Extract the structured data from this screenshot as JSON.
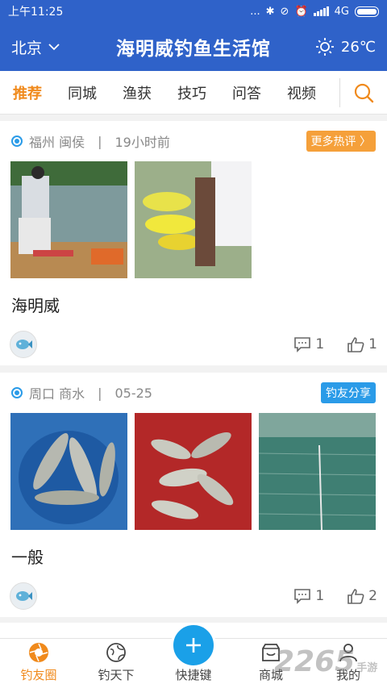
{
  "status_bar": {
    "time": "上午11:25",
    "network": "4G",
    "dots": "..."
  },
  "header": {
    "city": "北京",
    "title": "海明威钓鱼生活馆",
    "temperature": "26℃"
  },
  "tabs": [
    {
      "label": "推荐",
      "active": true
    },
    {
      "label": "同城"
    },
    {
      "label": "渔获"
    },
    {
      "label": "技巧"
    },
    {
      "label": "问答"
    },
    {
      "label": "视频"
    }
  ],
  "posts": [
    {
      "location": "福州 闽侯",
      "time": "19小时前",
      "badge": "更多热评 〉",
      "badge_color": "#f5a03a",
      "title": "海明威",
      "comments": "1",
      "likes": "1"
    },
    {
      "location": "周口 商水",
      "time": "05-25",
      "badge": "钓友分享",
      "badge_color": "#2a9be8",
      "title": "一般",
      "comments": "1",
      "likes": "2"
    }
  ],
  "bottom_nav": [
    {
      "label": "钓友圈",
      "icon": "aperture-icon",
      "active": true
    },
    {
      "label": "钓天下",
      "icon": "globe-icon"
    },
    {
      "label": "快捷键",
      "icon": "plus-icon"
    },
    {
      "label": "商城",
      "icon": "shop-icon"
    },
    {
      "label": "我的",
      "icon": "user-icon"
    }
  ],
  "watermark": {
    "text": "2265",
    "sub": "手游网"
  },
  "colors": {
    "primary": "#2f62c9",
    "accent": "#f08a1c",
    "fab": "#1aa0e8"
  }
}
